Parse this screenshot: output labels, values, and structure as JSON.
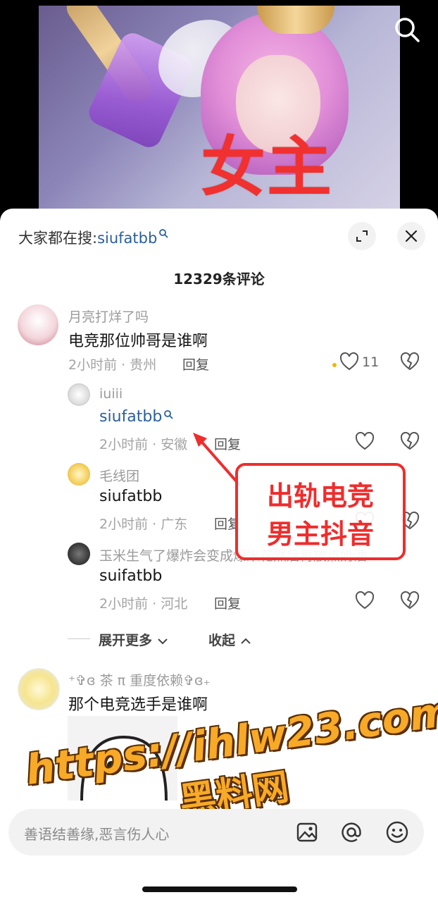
{
  "hero": {
    "overlay_text": "女主"
  },
  "search_hint": {
    "prefix": "大家都在搜:",
    "term": "siufatbb"
  },
  "comments_count": "12329条评论",
  "comments": [
    {
      "user": "月亮打烊了吗",
      "text": "电竞那位帅哥是谁啊",
      "time_location": "2小时前 · 贵州",
      "reply_label": "回复",
      "likes": "11",
      "replies": [
        {
          "user": "iuiii",
          "text": "siufatbb",
          "time_location": "2小时前 · 安徽",
          "reply_label": "回复"
        },
        {
          "user": "毛线团",
          "text": "siufatbb",
          "time_location": "2小时前 · 广东",
          "reply_label": "回复"
        },
        {
          "user": "玉米生气了爆炸会变成爆米花然后再放点奶油",
          "text": "suifatbb",
          "time_location": "2小时前 · 河北",
          "reply_label": "回复"
        }
      ]
    },
    {
      "user": "⁺✞ɞ 茶 π 重度依赖✞ɞ₊",
      "text": "那个电竞选手是谁啊"
    }
  ],
  "expand_more": "展开更多",
  "collapse": "收起",
  "annotation": {
    "line1": "出轨电竞",
    "line2": "男主抖音"
  },
  "watermark": {
    "line1": "https://ihlw23.com",
    "line2": "黑料网"
  },
  "input": {
    "placeholder": "善语结善缘,恶言伤人心"
  },
  "colors": {
    "link": "#2a5f9e",
    "annotation_red": "#ee2d2d",
    "watermark_orange": "#f7a928"
  }
}
